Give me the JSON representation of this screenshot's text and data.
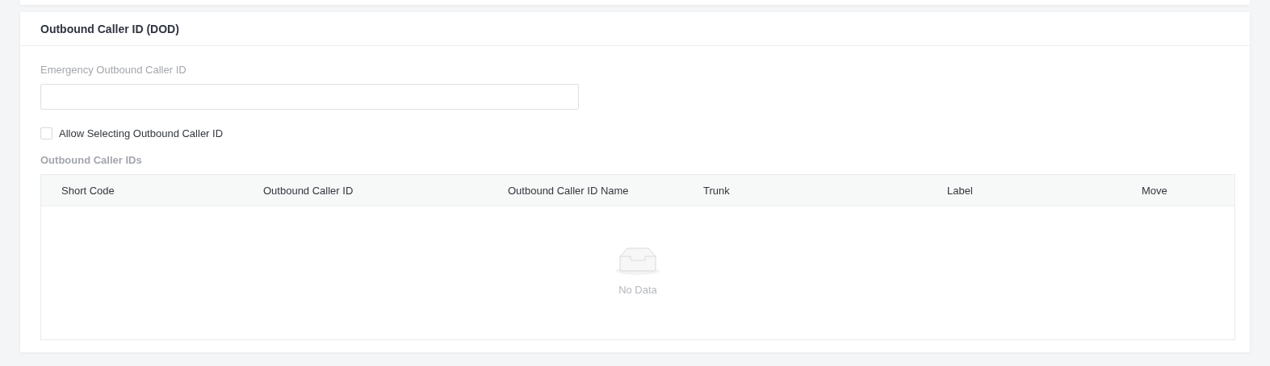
{
  "card": {
    "title": "Outbound Caller ID (DOD)"
  },
  "emergency_field": {
    "label": "Emergency Outbound Caller ID"
  },
  "allow_selecting": {
    "label": "Allow Selecting Outbound Caller ID",
    "checked": false
  },
  "section_title": "Outbound Caller IDs",
  "table": {
    "columns": [
      "Short Code",
      "Outbound Caller ID",
      "Outbound Caller ID Name",
      "Trunk",
      "Label",
      "Move"
    ],
    "empty_text": "No Data"
  }
}
